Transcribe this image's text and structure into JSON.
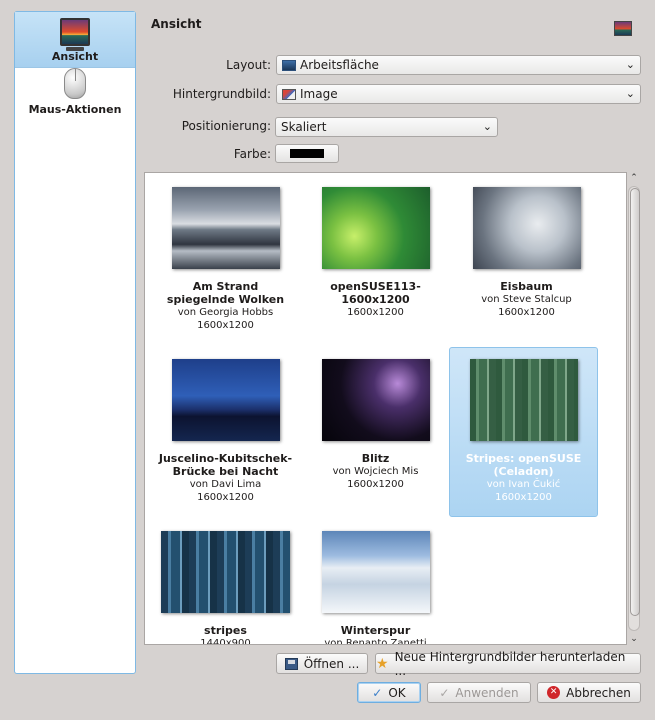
{
  "sidebar": {
    "items": [
      {
        "label": "Ansicht",
        "icon": "monitor-icon",
        "active": true
      },
      {
        "label": "Maus-Aktionen",
        "icon": "mouse-icon",
        "active": false
      }
    ]
  },
  "header": {
    "title": "Ansicht",
    "icon": "wallpaper-icon"
  },
  "form": {
    "layout": {
      "label": "Layout:",
      "value": "Arbeitsfläche"
    },
    "background": {
      "label": "Hintergrundbild:",
      "value": "Image"
    },
    "position": {
      "label": "Positionierung:",
      "value": "Skaliert"
    },
    "color": {
      "label": "Farbe:",
      "value": "#000000"
    }
  },
  "wallpapers": [
    {
      "name": "Am Strand spiegelnde Wolken",
      "author": "von Georgia Hobbs",
      "size": "1600x1200"
    },
    {
      "name": "openSUSE113-1600x1200",
      "author": "",
      "size": "1600x1200"
    },
    {
      "name": "Eisbaum",
      "author": "von Steve Stalcup",
      "size": "1600x1200"
    },
    {
      "name": "Juscelino-Kubitschek-Brücke bei Nacht",
      "author": "von Davi Lima",
      "size": "1600x1200"
    },
    {
      "name": "Blitz",
      "author": "von Wojciech Mis",
      "size": "1600x1200"
    },
    {
      "name": "Stripes: openSUSE (Celadon)",
      "author": "von Ivan Čukić",
      "size": "1600x1200",
      "selected": true
    },
    {
      "name": "stripes",
      "author": "",
      "size": "1440x900"
    },
    {
      "name": "Winterspur",
      "author": "von Renanto Zanetti",
      "size": ""
    }
  ],
  "buttons": {
    "open": "Öffnen ...",
    "download": "Neue Hintergrundbilder herunterladen ...",
    "ok": "OK",
    "apply": "Anwenden",
    "cancel": "Abbrechen"
  }
}
